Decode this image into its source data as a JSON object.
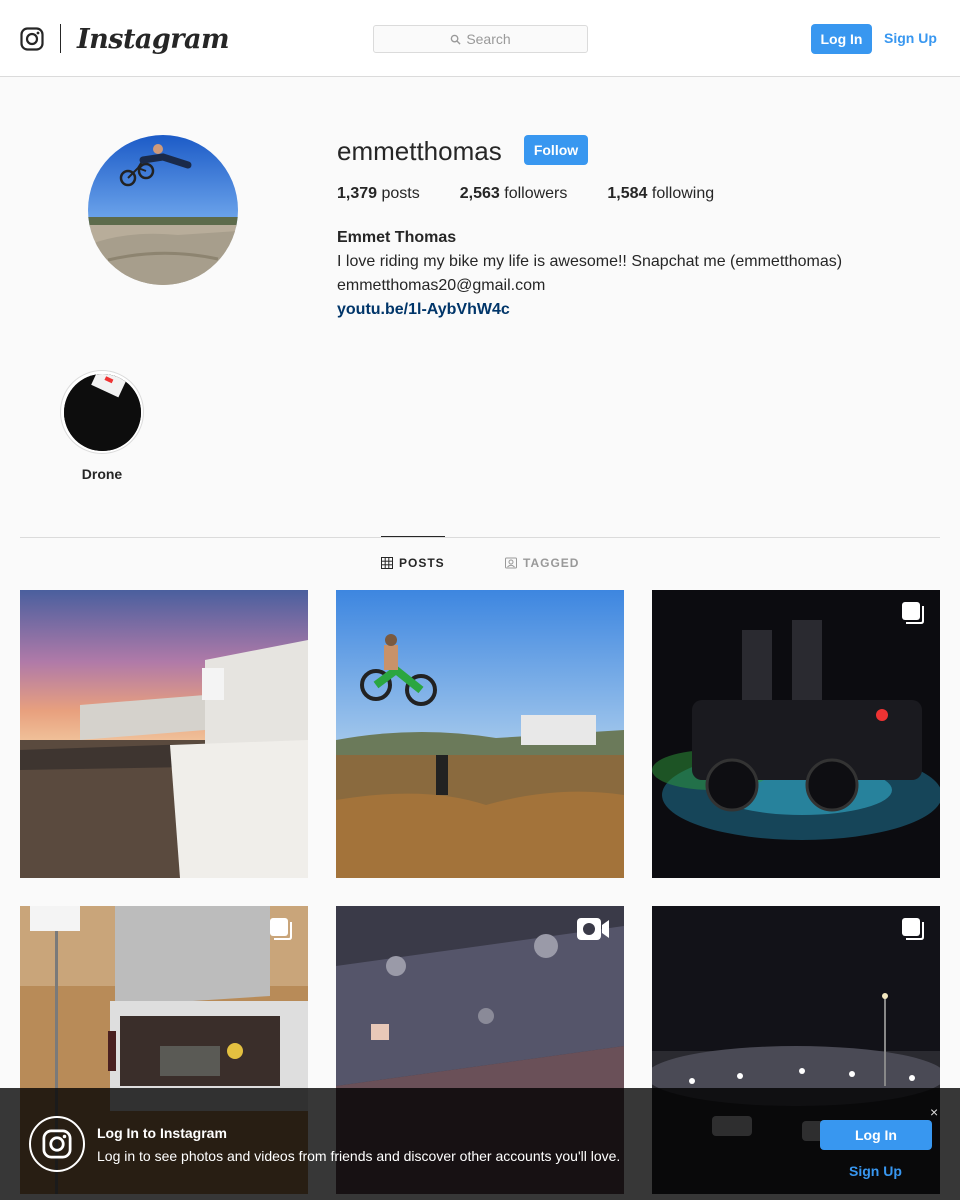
{
  "nav": {
    "wordmark": "Instagram",
    "search_placeholder": "Search",
    "login_label": "Log In",
    "signup_label": "Sign Up"
  },
  "profile": {
    "username": "emmetthomas",
    "follow_label": "Follow",
    "stats": {
      "posts_count": "1,379",
      "posts_label": "posts",
      "followers_count": "2,563",
      "followers_label": "followers",
      "following_count": "1,584",
      "following_label": "following"
    },
    "full_name": "Emmet Thomas",
    "bio_line": "I love riding my bike my life is awesome!! Snapchat me (emmetthomas)",
    "email": "emmetthomas20@gmail.com",
    "link": "youtu.be/1l-AybVhW4c"
  },
  "highlights": [
    {
      "label": "Drone"
    }
  ],
  "tabs": [
    {
      "label": "POSTS",
      "active": true
    },
    {
      "label": "TAGGED",
      "active": false
    }
  ],
  "posts": [
    {
      "type": "photo"
    },
    {
      "type": "photo"
    },
    {
      "type": "carousel"
    },
    {
      "type": "carousel"
    },
    {
      "type": "video"
    },
    {
      "type": "carousel"
    }
  ],
  "banner": {
    "title": "Log In to Instagram",
    "text": "Log in to see photos and videos from friends and discover other accounts you'll love.",
    "login_label": "Log In",
    "signup_label": "Sign Up",
    "close_glyph": "×"
  },
  "colors": {
    "accent": "#3897f0",
    "link": "#003569",
    "text": "#262626",
    "border": "#dbdbdb"
  }
}
